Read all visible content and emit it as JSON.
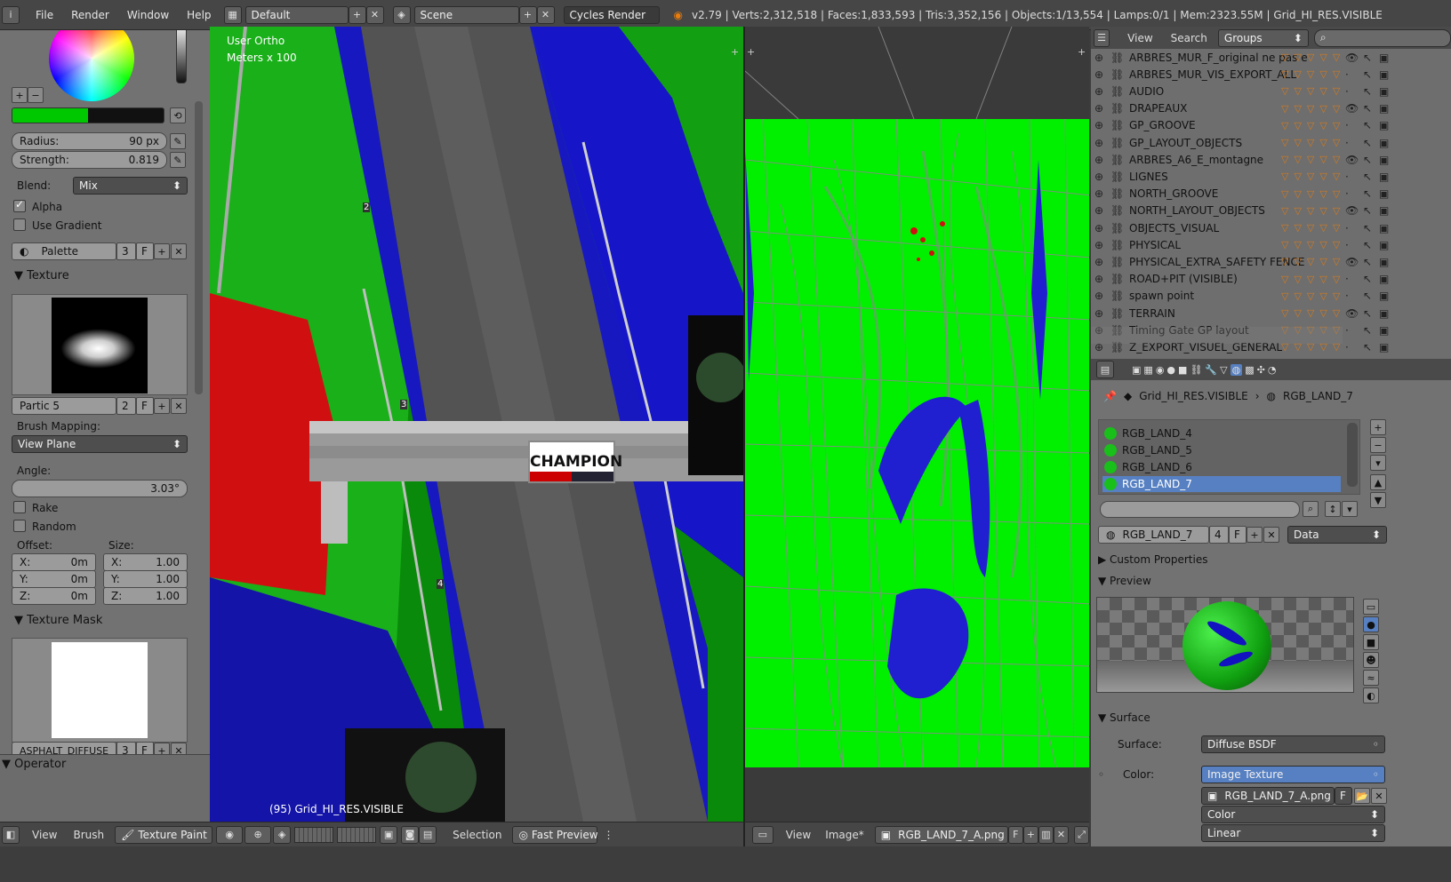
{
  "topbar": {
    "menus": [
      "File",
      "Render",
      "Window",
      "Help"
    ],
    "layout": "Default",
    "scene": "Scene",
    "engine": "Cycles Render",
    "stats": "v2.79 | Verts:2,312,518 | Faces:1,833,593 | Tris:3,352,156 | Objects:1/13,554 | Lamps:0/1 | Mem:2323.55M | Grid_HI_RES.VISIBLE"
  },
  "left": {
    "radius_label": "Radius:",
    "radius_value": "90 px",
    "strength_label": "Strength:",
    "strength_value": "0.819",
    "blend_label": "Blend:",
    "blend_value": "Mix",
    "alpha_label": "Alpha",
    "use_gradient_label": "Use Gradient",
    "palette_name": "Palette",
    "palette_users": "3",
    "f": "F",
    "texture_header": "Texture",
    "texture_name": "Partic 5",
    "texture_users": "2",
    "brush_mapping_label": "Brush Mapping:",
    "brush_mapping_value": "View Plane",
    "angle_label": "Angle:",
    "angle_value": "3.03°",
    "rake_label": "Rake",
    "random_label": "Random",
    "offset_label": "Offset:",
    "size_label": "Size:",
    "offset": [
      {
        "axis": "X:",
        "value": "0m"
      },
      {
        "axis": "Y:",
        "value": "0m"
      },
      {
        "axis": "Z:",
        "value": "0m"
      }
    ],
    "size": [
      {
        "axis": "X:",
        "value": "1.00"
      },
      {
        "axis": "Y:",
        "value": "1.00"
      },
      {
        "axis": "Z:",
        "value": "1.00"
      }
    ],
    "texture_mask_header": "Texture Mask",
    "mask_name": "ASPHALT_DIFFUSE",
    "mask_users": "3",
    "operator_header": "Operator"
  },
  "viewport": {
    "view_label": "User Ortho",
    "scale_label": "Meters x 100",
    "object_label": "(95) Grid_HI_RES.VISIBLE",
    "banner_text": "CHAMPION",
    "markers": [
      "2",
      "3",
      "4"
    ]
  },
  "bottom_left": {
    "view": "View",
    "brush": "Brush",
    "mode": "Texture Paint",
    "selection": "Selection",
    "fast_preview": "Fast Preview"
  },
  "bottom_uv": {
    "view": "View",
    "image": "Image*",
    "image_name": "RGB_LAND_7_A.png",
    "f": "F"
  },
  "outliner": {
    "view": "View",
    "search": "Search",
    "display_mode": "Groups",
    "groups": [
      "ARBRES_MUR_F_original ne pas exporter",
      "ARBRES_MUR_VIS_EXPORT_ALL",
      "AUDIO",
      "DRAPEAUX",
      "GP_GROOVE",
      "GP_LAYOUT_OBJECTS",
      "ARBRES_A6_E_montagne",
      "LIGNES",
      "NORTH_GROOVE",
      "NORTH_LAYOUT_OBJECTS",
      "OBJECTS_VISUAL",
      "PHYSICAL",
      "PHYSICAL_EXTRA_SAFETY FENCE",
      "ROAD+PIT (VISIBLE)",
      "spawn point",
      "TERRAIN",
      "Timing Gate GP layout",
      "Z_EXPORT_VISUEL_GENERAL"
    ]
  },
  "props": {
    "breadcrumb_object": "Grid_HI_RES.VISIBLE",
    "breadcrumb_material": "RGB_LAND_7",
    "materials": [
      "RGB_LAND_4",
      "RGB_LAND_5",
      "RGB_LAND_6",
      "RGB_LAND_7"
    ],
    "selected_material": "RGB_LAND_7",
    "material_name": "RGB_LAND_7",
    "material_users": "4",
    "f": "F",
    "link": "Data",
    "custom_properties": "Custom Properties",
    "preview": "Preview",
    "surface_header": "Surface",
    "surface_label": "Surface:",
    "surface_value": "Diffuse BSDF",
    "color_label": "Color:",
    "color_value": "Image Texture",
    "image_name": "RGB_LAND_7_A.png",
    "color_space": "Color",
    "interpolation": "Linear"
  },
  "colors": {
    "accent": "#5680c2",
    "green": "#00e000",
    "blue": "#1010d0",
    "red": "#e01010"
  }
}
